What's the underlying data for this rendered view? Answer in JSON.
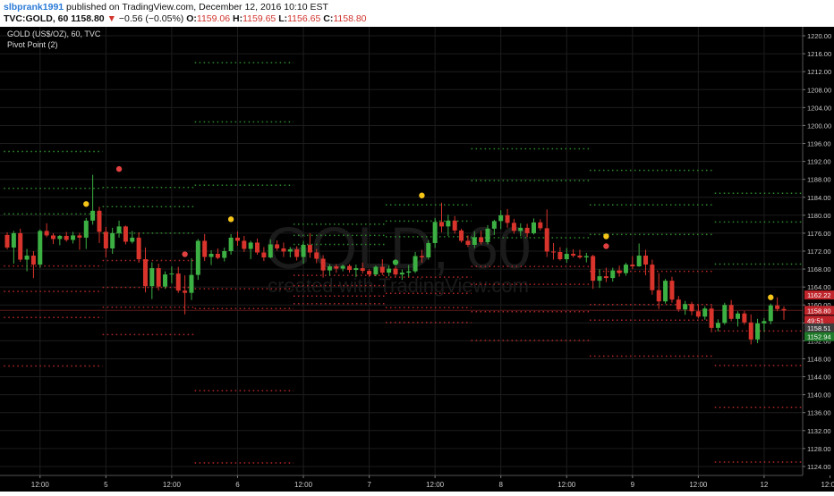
{
  "header": {
    "author": "slbprank1991",
    "published": "published on TradingView.com, December 12, 2016 10:10 EST",
    "symbol": "TVC:GOLD, 60",
    "last": "1158.80",
    "change_arrow": "▼",
    "change": "−0.56 (−0.05%)",
    "open_label": "O:",
    "open": "1159.06",
    "high_label": "H:",
    "high": "1159.65",
    "low_label": "L:",
    "low": "1156.65",
    "close_label": "C:",
    "close": "1158.80"
  },
  "legend": {
    "title": "GOLD (US$/OZ), 60, TVC",
    "indicator": "Pivot Point (2)"
  },
  "watermark": {
    "symbol": "GOLD, 60",
    "site": "created with TradingView.com"
  },
  "colors": {
    "bg": "#000000",
    "up": "#3cb043",
    "down": "#d8342c",
    "pivot_green": "#2e8b2e",
    "pivot_red": "#b52828",
    "marker_yellow": "#f5c518",
    "marker_red": "#e04040",
    "grid": "#1d1d1d"
  },
  "chart_data": {
    "type": "candlestick",
    "ylim": [
      1122,
      1222
    ],
    "y_ticks": [
      "1124.00",
      "1128.00",
      "1132.00",
      "1136.00",
      "1140.00",
      "1144.00",
      "1148.00",
      "1152.00",
      "1156.00",
      "1160.00",
      "1164.00",
      "1168.00",
      "1172.00",
      "1176.00",
      "1180.00",
      "1184.00",
      "1188.00",
      "1192.00",
      "1196.00",
      "1200.00",
      "1204.00",
      "1208.00",
      "1212.00",
      "1216.00",
      "1220.00"
    ],
    "x_ticks": [
      {
        "label": "12:00",
        "i": 5
      },
      {
        "label": "5",
        "i": 15
      },
      {
        "label": "12:00",
        "i": 25
      },
      {
        "label": "6",
        "i": 35
      },
      {
        "label": "12:00",
        "i": 45
      },
      {
        "label": "7",
        "i": 55
      },
      {
        "label": "12:00",
        "i": 65
      },
      {
        "label": "8",
        "i": 75
      },
      {
        "label": "12:00",
        "i": 85
      },
      {
        "label": "9",
        "i": 95
      },
      {
        "label": "12:00",
        "i": 105
      },
      {
        "label": "12",
        "i": 115
      },
      {
        "label": "12:00",
        "i": 125
      },
      {
        "label": "20:0",
        "i": 131
      }
    ],
    "price_badges": [
      {
        "text": "1162.22",
        "value": 1162.22,
        "color": "#c0252b"
      },
      {
        "text": "1158.80",
        "value": 1158.8,
        "color": "#c0252b"
      },
      {
        "text": "49:51",
        "value": 1156.6,
        "color": "#c0252b"
      },
      {
        "text": "1158.51",
        "value": 1154.9,
        "color": "#3c3c3c"
      },
      {
        "text": "1152.94",
        "value": 1152.94,
        "color": "#1f7a2a"
      }
    ],
    "candles": [
      [
        1175.6,
        1176.2,
        1172.4,
        1172.8
      ],
      [
        1172.8,
        1176.5,
        1169.2,
        1176.0
      ],
      [
        1176.0,
        1177.0,
        1169.6,
        1170.1
      ],
      [
        1170.1,
        1172.5,
        1167.5,
        1171.0
      ],
      [
        1171.0,
        1172.0,
        1166.0,
        1169.0
      ],
      [
        1169.0,
        1176.8,
        1168.3,
        1176.5
      ],
      [
        1176.5,
        1178.2,
        1175.1,
        1175.5
      ],
      [
        1175.5,
        1176.0,
        1173.6,
        1174.7
      ],
      [
        1174.7,
        1175.6,
        1173.3,
        1175.4
      ],
      [
        1175.4,
        1176.3,
        1174.1,
        1174.5
      ],
      [
        1174.5,
        1176.3,
        1173.7,
        1175.5
      ],
      [
        1175.5,
        1176.1,
        1172.3,
        1175.0
      ],
      [
        1175.0,
        1179.4,
        1172.5,
        1178.8
      ],
      [
        1178.8,
        1189.0,
        1177.9,
        1181.0
      ],
      [
        1181.0,
        1181.9,
        1173.8,
        1176.3
      ],
      [
        1176.3,
        1177.4,
        1170.6,
        1172.6
      ],
      [
        1172.6,
        1177.2,
        1171.4,
        1176.0
      ],
      [
        1176.0,
        1178.8,
        1175.0,
        1177.5
      ],
      [
        1177.5,
        1177.7,
        1173.5,
        1174.1
      ],
      [
        1174.1,
        1176.5,
        1173.7,
        1175.0
      ],
      [
        1175.0,
        1176.2,
        1169.4,
        1170.2
      ],
      [
        1170.2,
        1172.8,
        1162.8,
        1164.2
      ],
      [
        1164.2,
        1169.5,
        1161.3,
        1168.2
      ],
      [
        1168.2,
        1169.2,
        1163.2,
        1164.1
      ],
      [
        1164.1,
        1167.5,
        1163.6,
        1166.8
      ],
      [
        1166.8,
        1168.6,
        1164.8,
        1167.0
      ],
      [
        1167.0,
        1168.5,
        1162.7,
        1163.2
      ],
      [
        1163.2,
        1166.6,
        1157.9,
        1162.7
      ],
      [
        1162.7,
        1170.4,
        1161.1,
        1166.7
      ],
      [
        1166.7,
        1174.7,
        1165.6,
        1174.3
      ],
      [
        1174.3,
        1175.8,
        1169.8,
        1170.7
      ],
      [
        1170.7,
        1172.2,
        1168.9,
        1171.4
      ],
      [
        1171.4,
        1172.6,
        1170.2,
        1170.5
      ],
      [
        1170.5,
        1172.8,
        1169.7,
        1172.0
      ],
      [
        1172.0,
        1175.8,
        1171.2,
        1175.0
      ],
      [
        1175.0,
        1176.4,
        1173.2,
        1174.3
      ],
      [
        1174.3,
        1175.4,
        1171.8,
        1172.5
      ],
      [
        1172.5,
        1174.3,
        1170.2,
        1173.9
      ],
      [
        1173.9,
        1174.8,
        1171.2,
        1171.7
      ],
      [
        1171.7,
        1172.9,
        1169.8,
        1170.6
      ],
      [
        1170.6,
        1174.6,
        1170.4,
        1173.5
      ],
      [
        1173.5,
        1174.4,
        1172.1,
        1172.6
      ],
      [
        1172.6,
        1173.9,
        1170.7,
        1171.9
      ],
      [
        1171.9,
        1172.9,
        1170.6,
        1172.4
      ],
      [
        1172.4,
        1173.1,
        1169.9,
        1170.7
      ],
      [
        1170.7,
        1174.3,
        1169.2,
        1173.4
      ],
      [
        1173.4,
        1176.0,
        1170.5,
        1171.7
      ],
      [
        1171.7,
        1172.5,
        1169.3,
        1170.3
      ],
      [
        1170.3,
        1171.1,
        1166.1,
        1167.7
      ],
      [
        1167.7,
        1169.1,
        1166.5,
        1168.6
      ],
      [
        1168.6,
        1169.1,
        1167.2,
        1168.1
      ],
      [
        1168.1,
        1169.0,
        1167.5,
        1168.7
      ],
      [
        1168.7,
        1169.1,
        1167.2,
        1167.8
      ],
      [
        1167.8,
        1169.0,
        1166.2,
        1168.2
      ],
      [
        1168.2,
        1169.4,
        1167.0,
        1167.6
      ],
      [
        1167.6,
        1168.0,
        1166.3,
        1166.8
      ],
      [
        1166.8,
        1168.8,
        1166.4,
        1168.5
      ],
      [
        1168.5,
        1170.2,
        1166.7,
        1167.2
      ],
      [
        1167.2,
        1168.9,
        1166.4,
        1168.1
      ],
      [
        1168.1,
        1168.6,
        1166.3,
        1166.8
      ],
      [
        1166.8,
        1167.9,
        1165.6,
        1167.2
      ],
      [
        1167.2,
        1168.9,
        1166.3,
        1167.5
      ],
      [
        1167.5,
        1171.8,
        1167.1,
        1170.9
      ],
      [
        1170.9,
        1172.3,
        1169.4,
        1170.6
      ],
      [
        1170.6,
        1174.4,
        1170.1,
        1173.8
      ],
      [
        1173.8,
        1179.4,
        1172.7,
        1178.5
      ],
      [
        1178.5,
        1182.8,
        1176.2,
        1177.5
      ],
      [
        1177.5,
        1180.1,
        1175.4,
        1178.8
      ],
      [
        1178.8,
        1179.8,
        1175.9,
        1176.6
      ],
      [
        1176.6,
        1177.0,
        1173.9,
        1174.3
      ],
      [
        1174.3,
        1175.5,
        1172.9,
        1173.4
      ],
      [
        1173.4,
        1176.4,
        1172.7,
        1175.1
      ],
      [
        1175.1,
        1176.5,
        1173.5,
        1174.0
      ],
      [
        1174.0,
        1177.8,
        1173.5,
        1177.0
      ],
      [
        1177.0,
        1179.0,
        1175.6,
        1178.7
      ],
      [
        1178.7,
        1181.1,
        1176.9,
        1180.0
      ],
      [
        1180.0,
        1181.4,
        1177.2,
        1178.3
      ],
      [
        1178.3,
        1179.2,
        1175.9,
        1176.5
      ],
      [
        1176.5,
        1178.2,
        1175.3,
        1177.2
      ],
      [
        1177.2,
        1178.1,
        1175.1,
        1176.0
      ],
      [
        1176.0,
        1179.3,
        1175.7,
        1178.4
      ],
      [
        1178.4,
        1179.1,
        1176.6,
        1177.1
      ],
      [
        1177.1,
        1181.3,
        1170.7,
        1171.9
      ],
      [
        1171.9,
        1173.8,
        1170.1,
        1171.8
      ],
      [
        1171.8,
        1172.9,
        1169.9,
        1170.2
      ],
      [
        1170.2,
        1172.7,
        1169.4,
        1171.4
      ],
      [
        1171.4,
        1172.4,
        1170.6,
        1171.0
      ],
      [
        1171.0,
        1172.3,
        1170.3,
        1170.6
      ],
      [
        1170.6,
        1171.6,
        1169.5,
        1170.9
      ],
      [
        1170.9,
        1171.2,
        1163.6,
        1165.4
      ],
      [
        1165.4,
        1168.0,
        1163.8,
        1166.4
      ],
      [
        1166.4,
        1168.3,
        1165.1,
        1166.0
      ],
      [
        1166.0,
        1168.3,
        1165.2,
        1167.7
      ],
      [
        1167.7,
        1168.8,
        1166.3,
        1167.1
      ],
      [
        1167.1,
        1169.4,
        1166.5,
        1169.0
      ],
      [
        1169.0,
        1170.9,
        1168.0,
        1168.6
      ],
      [
        1168.6,
        1173.7,
        1168.5,
        1171.0
      ],
      [
        1171.0,
        1172.3,
        1166.6,
        1169.0
      ],
      [
        1169.0,
        1170.1,
        1162.3,
        1163.3
      ],
      [
        1163.3,
        1167.1,
        1159.1,
        1160.8
      ],
      [
        1160.8,
        1165.8,
        1160.3,
        1165.4
      ],
      [
        1165.4,
        1166.3,
        1160.5,
        1161.2
      ],
      [
        1161.2,
        1162.0,
        1158.5,
        1159.0
      ],
      [
        1159.0,
        1160.9,
        1157.8,
        1160.2
      ],
      [
        1160.2,
        1160.7,
        1157.7,
        1158.6
      ],
      [
        1158.6,
        1160.1,
        1157.0,
        1157.4
      ],
      [
        1157.4,
        1159.7,
        1156.7,
        1159.2
      ],
      [
        1159.2,
        1159.9,
        1153.9,
        1154.9
      ],
      [
        1154.9,
        1156.8,
        1154.1,
        1156.0
      ],
      [
        1156.0,
        1160.5,
        1155.6,
        1160.0
      ],
      [
        1160.0,
        1161.1,
        1156.4,
        1156.9
      ],
      [
        1156.9,
        1158.6,
        1155.2,
        1158.1
      ],
      [
        1158.1,
        1158.7,
        1155.6,
        1156.1
      ],
      [
        1156.1,
        1157.9,
        1151.2,
        1152.3
      ],
      [
        1152.3,
        1156.9,
        1151.5,
        1155.9
      ],
      [
        1155.9,
        1157.1,
        1154.0,
        1156.4
      ],
      [
        1156.4,
        1160.3,
        1155.7,
        1159.9
      ],
      [
        1159.9,
        1161.7,
        1158.6,
        1159.1
      ],
      [
        1159.1,
        1159.7,
        1156.7,
        1158.8
      ]
    ],
    "markers": [
      {
        "i": 12,
        "value": 1182.5,
        "color": "yellow"
      },
      {
        "i": 17,
        "value": 1190.3,
        "color": "red"
      },
      {
        "i": 27,
        "value": 1171.3,
        "color": "red"
      },
      {
        "i": 34,
        "value": 1179.1,
        "color": "yellow"
      },
      {
        "i": 59,
        "value": 1169.5,
        "color": "green"
      },
      {
        "i": 63,
        "value": 1184.4,
        "color": "yellow"
      },
      {
        "i": 91,
        "value": 1175.3,
        "color": "yellow"
      },
      {
        "i": 91,
        "value": 1173.1,
        "color": "red"
      },
      {
        "i": 116,
        "value": 1161.7,
        "color": "yellow"
      }
    ],
    "pivot_segments": [
      {
        "i0": 0,
        "i1": 14,
        "values": {
          "g": [
            1194.2,
            1186.0,
            1180.3
          ],
          "r": [
            1168.7,
            1163.0,
            1157.2,
            1146.4
          ]
        }
      },
      {
        "i0": 15,
        "i1": 28,
        "values": {
          "g": [
            1186.2,
            1181.9,
            1176.0
          ],
          "r": [
            1169.9,
            1163.9,
            1159.5,
            1153.4
          ]
        }
      },
      {
        "i0": 29,
        "i1": 43,
        "values": {
          "g": [
            1214.0,
            1200.8,
            1186.7
          ],
          "r": [
            1163.6,
            1159.2,
            1140.9,
            1124.8
          ]
        }
      },
      {
        "i0": 44,
        "i1": 57,
        "values": {
          "g": [
            1178.0,
            1175.5,
            1173.5
          ],
          "r": [
            1166.6,
            1164.3,
            1162.0,
            1160.3
          ]
        }
      },
      {
        "i0": 58,
        "i1": 70,
        "values": {
          "g": [
            1182.3,
            1178.7,
            1175.2
          ],
          "r": [
            1166.2,
            1162.6,
            1159.4,
            1156.1
          ]
        }
      },
      {
        "i0": 71,
        "i1": 88,
        "values": {
          "g": [
            1194.8,
            1187.7,
            1175.0
          ],
          "r": [
            1168.6,
            1164.6,
            1158.5,
            1152.1
          ]
        }
      },
      {
        "i0": 89,
        "i1": 107,
        "values": {
          "g": [
            1190.0,
            1182.3,
            1175.7
          ],
          "r": [
            1167.5,
            1160.1,
            1156.6,
            1148.6
          ]
        }
      },
      {
        "i0": 108,
        "i1": 123,
        "values": {
          "g": [
            1184.9,
            1178.5,
            1169.1
          ],
          "r": [
            1154.2,
            1146.5,
            1137.2,
            1125.0
          ]
        }
      }
    ]
  }
}
